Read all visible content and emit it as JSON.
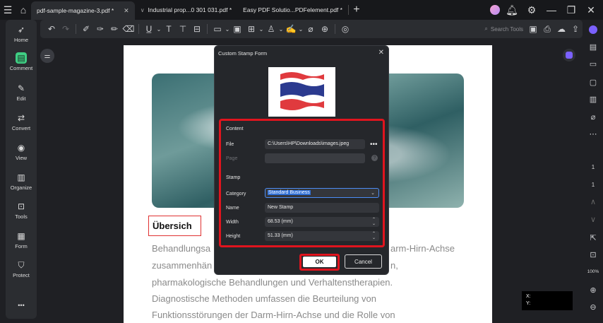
{
  "titlebar": {
    "tabs": [
      {
        "label": "pdf-sample-magazine-3.pdf *",
        "active": true
      },
      {
        "label": "Industrial  prop...0 301 031.pdf *",
        "active": false
      },
      {
        "label": "Easy PDF Solutio...PDFelement.pdf *",
        "active": false
      }
    ],
    "new_tab": "+"
  },
  "toolbar": {
    "search_label": "Search Tools"
  },
  "sidebar": {
    "items": [
      {
        "label": "Home",
        "icon": "rocket-icon"
      },
      {
        "label": "Comment",
        "icon": "comment-icon"
      },
      {
        "label": "Edit",
        "icon": "edit-icon"
      },
      {
        "label": "Convert",
        "icon": "convert-icon"
      },
      {
        "label": "View",
        "icon": "eye-icon"
      },
      {
        "label": "Organize",
        "icon": "organize-icon"
      },
      {
        "label": "Tools",
        "icon": "toolbox-icon"
      },
      {
        "label": "Form",
        "icon": "form-icon"
      },
      {
        "label": "Protect",
        "icon": "shield-icon"
      }
    ],
    "more": "•••"
  },
  "rightbar": {
    "page_current": "1",
    "page_total": "1",
    "zoom": "100%"
  },
  "document": {
    "heading": "Übersich",
    "paragraph": [
      "Behandlungsa",
      "zusammenhän",
      "pharmakologische Behandlungen und Verhaltenstherapien.",
      "Diagnostische Methoden umfassen die Beurteilung von",
      "Funktionsstörungen der Darm-Hirn-Achse und die Rolle von"
    ],
    "paragraph_right": [
      "arm-Hirn-Achse",
      "n,"
    ]
  },
  "dialog": {
    "title": "Custom Stamp Form",
    "content_section": "Content",
    "file_label": "File",
    "file_value": "C:\\Users\\HP\\Downloads\\images.jpeg",
    "page_label": "Page",
    "stamp_section": "Stamp",
    "category_label": "Category",
    "category_value": "Standard Business",
    "name_label": "Name",
    "name_value": "New Stamp",
    "width_label": "Width",
    "width_value": "68.53  (mm)",
    "height_label": "Height",
    "height_value": "51.33  (mm)",
    "ok_label": "OK",
    "cancel_label": "Cancel"
  },
  "coord": {
    "x_label": "X:",
    "y_label": "Y:"
  },
  "colors": {
    "app_bg": "#1f2024",
    "panel_bg": "#2b2d31",
    "highlight_red": "#e0141e",
    "accent_green": "#3fcf84",
    "select_blue": "#2f6fd6"
  }
}
